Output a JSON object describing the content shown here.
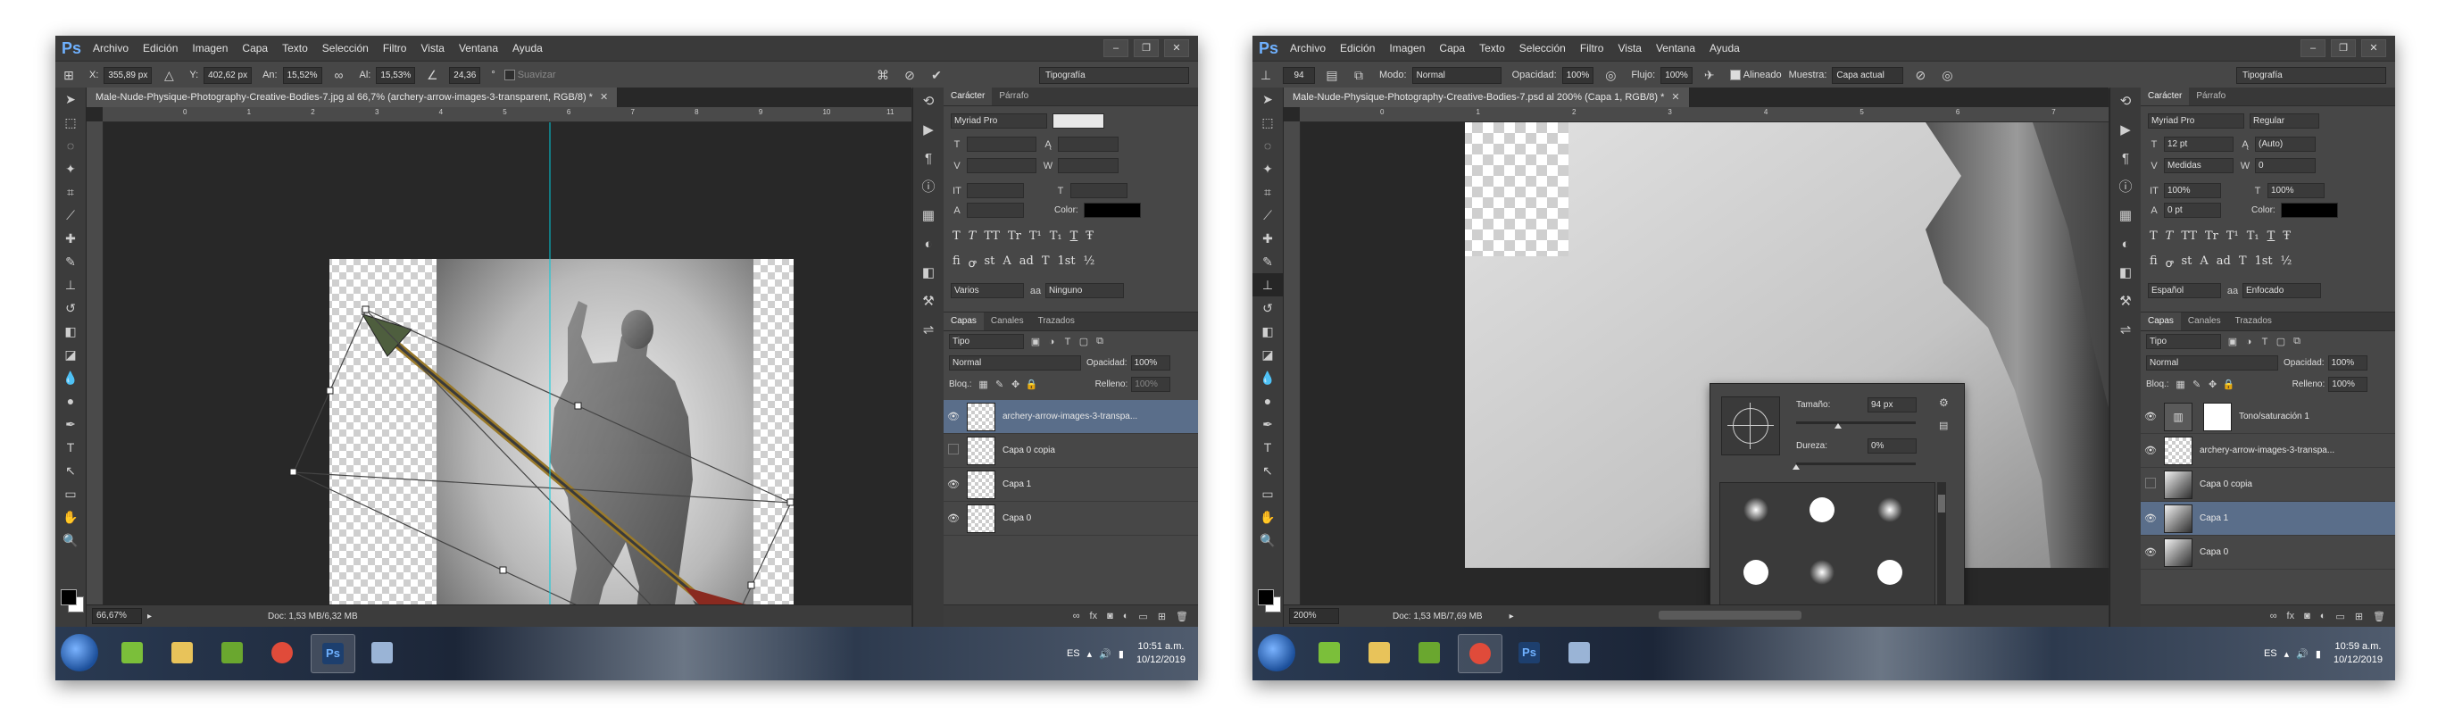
{
  "common": {
    "app_logo": "Ps",
    "menu": [
      "Archivo",
      "Edición",
      "Imagen",
      "Capa",
      "Texto",
      "Selección",
      "Filtro",
      "Vista",
      "Ventana",
      "Ayuda"
    ],
    "workspace": "Tipografía",
    "character_tabs": [
      "Carácter",
      "Párrafo"
    ],
    "layers_tabs": [
      "Capas",
      "Canales",
      "Trazados"
    ],
    "filter_kind": "Tipo",
    "blend_mode": "Normal",
    "opacity_label": "Opacidad:",
    "opacity_value": "100%",
    "lock_label": "Bloq.:",
    "fill_label": "Relleno:",
    "fill_value": "100%",
    "color_label": "Color:",
    "glyphs": [
      "T",
      "T",
      "TT",
      "Tr",
      "T¹",
      "T₁",
      "T",
      "Ŧ"
    ],
    "glyphs2": [
      "fi",
      "ꝍ",
      "st",
      "A",
      "ad",
      "T",
      "1st",
      "½"
    ],
    "tray_lang": "ES",
    "taskbar_icons": [
      "windows-start",
      "paint-app",
      "folder",
      "utorrent",
      "chrome",
      "photoshop",
      "paintbrush"
    ]
  },
  "shot1": {
    "doc_tab": "Male-Nude-Physique-Photography-Creative-Bodies-7.jpg al 66,7% (archery-arrow-images-3-transparent, RGB/8) *",
    "options": {
      "x_label": "X:",
      "x_value": "355,89 px",
      "y_label": "Y:",
      "y_value": "402,62 px",
      "w_label": "An:",
      "w_value": "15,52%",
      "h_label": "Al:",
      "h_value": "15,53%",
      "angle_value": "24,36",
      "angle_unit": "°",
      "smooth_label": "Suavizar"
    },
    "ruler_ticks": [
      "0",
      "1",
      "2",
      "3",
      "4",
      "5",
      "6",
      "7",
      "8",
      "9",
      "10",
      "11"
    ],
    "zoom": "66,67%",
    "doc_info": "Doc: 1,53 MB/6,32 MB",
    "char": {
      "font": "Myriad Pro",
      "style": "",
      "size": "",
      "leading": "",
      "kerning": "",
      "tracking": "",
      "lang": "Varios",
      "aa_icon": "aa",
      "aa": "Ninguno"
    },
    "layers": [
      {
        "name": "archery-arrow-images-3-transpa...",
        "thumb": "checker",
        "visible": true,
        "selected": true
      },
      {
        "name": "Capa 0 copia",
        "thumb": "checker",
        "visible": false,
        "selected": false
      },
      {
        "name": "Capa 1",
        "thumb": "checker",
        "visible": true,
        "selected": false
      },
      {
        "name": "Capa 0",
        "thumb": "checker",
        "visible": true,
        "selected": false
      }
    ],
    "clock_time": "10:51 a.m.",
    "clock_date": "10/12/2019",
    "active_app": 5
  },
  "shot2": {
    "doc_tab": "Male-Nude-Physique-Photography-Creative-Bodies-7.psd al 200% (Capa 1, RGB/8) *",
    "options": {
      "brush_size": "94",
      "mode_label": "Modo:",
      "mode_value": "Normal",
      "opacity_label": "Opacidad:",
      "opacity_value": "100%",
      "flow_label": "Flujo:",
      "flow_value": "100%",
      "aligned_label": "Alineado",
      "sample_label": "Muestra:",
      "sample_value": "Capa actual"
    },
    "ruler_ticks": [
      "0",
      "1",
      "2",
      "3",
      "4",
      "5",
      "6",
      "7"
    ],
    "zoom": "200%",
    "doc_info": "Doc: 1,53 MB/7,69 MB",
    "brush_popup": {
      "size_label": "Tamaño:",
      "size_value": "94 px",
      "size_level": 0.35,
      "hardness_label": "Dureza:",
      "hardness_value": "0%",
      "hardness_level": 0.0
    },
    "char": {
      "font": "Myriad Pro",
      "style": "Regular",
      "size": "12 pt",
      "leading": "(Auto)",
      "kerning": "Medidas",
      "tracking": "0",
      "vscale": "100%",
      "hscale": "100%",
      "baseline": "0 pt",
      "lang": "Español",
      "aa_icon": "aa",
      "aa": "Enfocado"
    },
    "layers": [
      {
        "name": "Tono/saturación 1",
        "thumb": "adj",
        "visible": true,
        "selected": false
      },
      {
        "name": "archery-arrow-images-3-transpa...",
        "thumb": "checker",
        "visible": true,
        "selected": false
      },
      {
        "name": "Capa 0 copia",
        "thumb": "photo",
        "visible": false,
        "selected": false
      },
      {
        "name": "Capa 1",
        "thumb": "photo",
        "visible": true,
        "selected": true
      },
      {
        "name": "Capa 0",
        "thumb": "photo",
        "visible": true,
        "selected": false
      }
    ],
    "clock_time": "10:59 a.m.",
    "clock_date": "10/12/2019",
    "active_app": 4
  }
}
